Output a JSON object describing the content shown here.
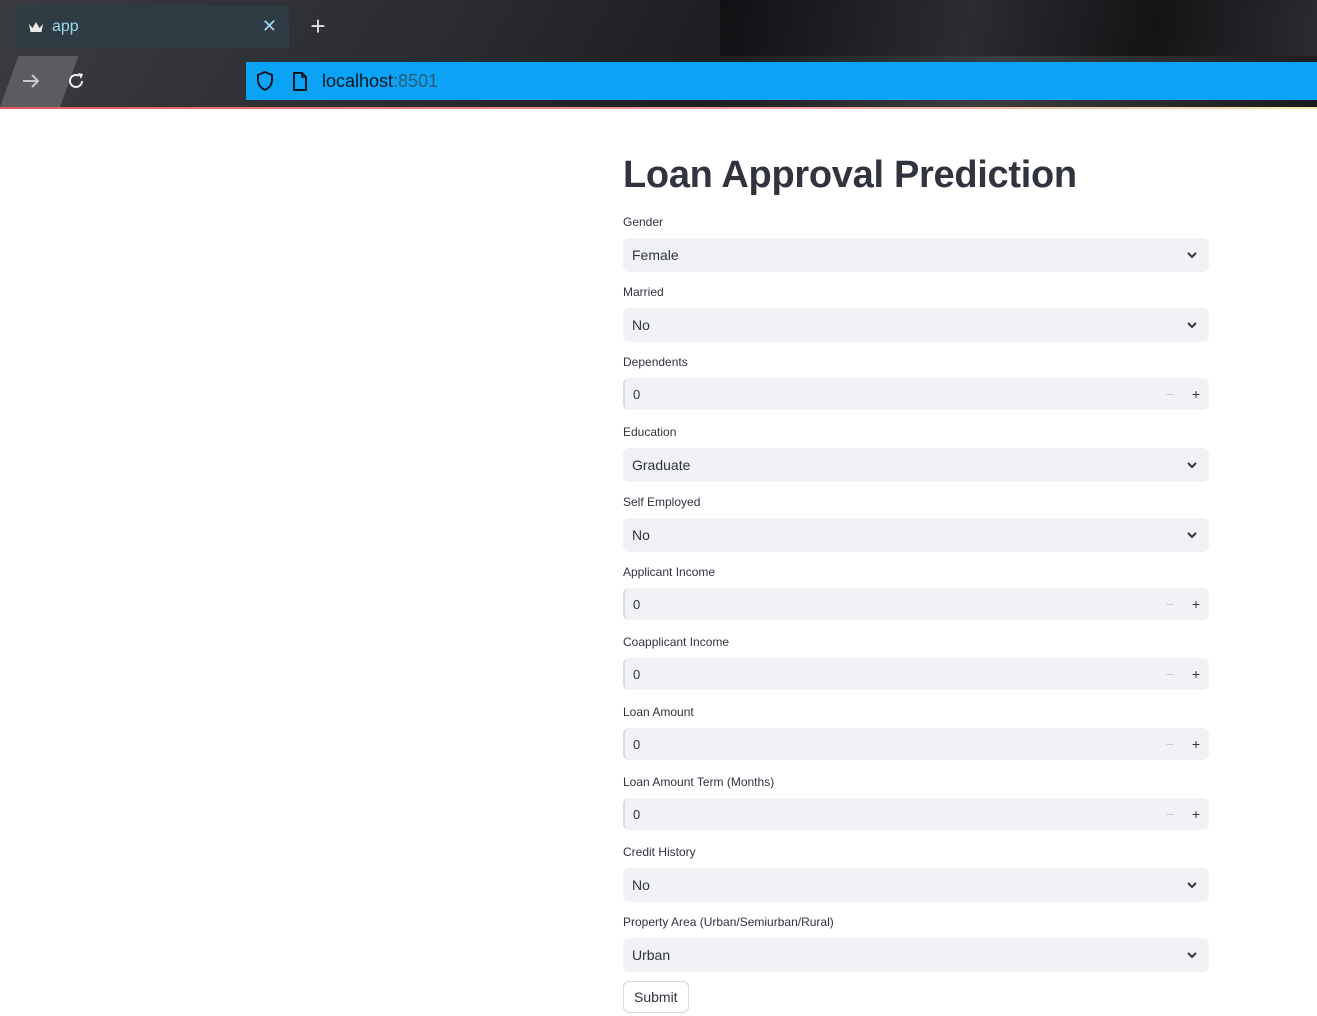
{
  "browser": {
    "tab_title": "app",
    "url_host": "localhost",
    "url_port": ":8501"
  },
  "app": {
    "title": "Loan Approval Prediction",
    "fields": [
      {
        "label": "Gender",
        "type": "select",
        "value": "Female"
      },
      {
        "label": "Married",
        "type": "select",
        "value": "No"
      },
      {
        "label": "Dependents",
        "type": "number",
        "value": "0"
      },
      {
        "label": "Education",
        "type": "select",
        "value": "Graduate"
      },
      {
        "label": "Self Employed",
        "type": "select",
        "value": "No"
      },
      {
        "label": "Applicant Income",
        "type": "number",
        "value": "0"
      },
      {
        "label": "Coapplicant Income",
        "type": "number",
        "value": "0"
      },
      {
        "label": "Loan Amount",
        "type": "number",
        "value": "0"
      },
      {
        "label": "Loan Amount Term (Months)",
        "type": "number",
        "value": "0"
      },
      {
        "label": "Credit History",
        "type": "select",
        "value": "No"
      },
      {
        "label": "Property Area (Urban/Semiurban/Rural)",
        "type": "select",
        "value": "Urban"
      }
    ],
    "submit_label": "Submit"
  },
  "icons": {
    "tab": "crown-icon",
    "close": "close-icon",
    "new_tab": "plus-icon",
    "forward": "arrow-right-icon",
    "reload": "reload-icon",
    "security": "shield-icon",
    "page": "page-icon",
    "select": "chevron-down-icon",
    "decrement": "minus-icon",
    "increment": "plus-icon"
  },
  "colors": {
    "url_bar": "#0aa3f5",
    "tab_bg": "#2f3c44",
    "input_bg": "#f0f2f6",
    "text": "#31333f"
  }
}
